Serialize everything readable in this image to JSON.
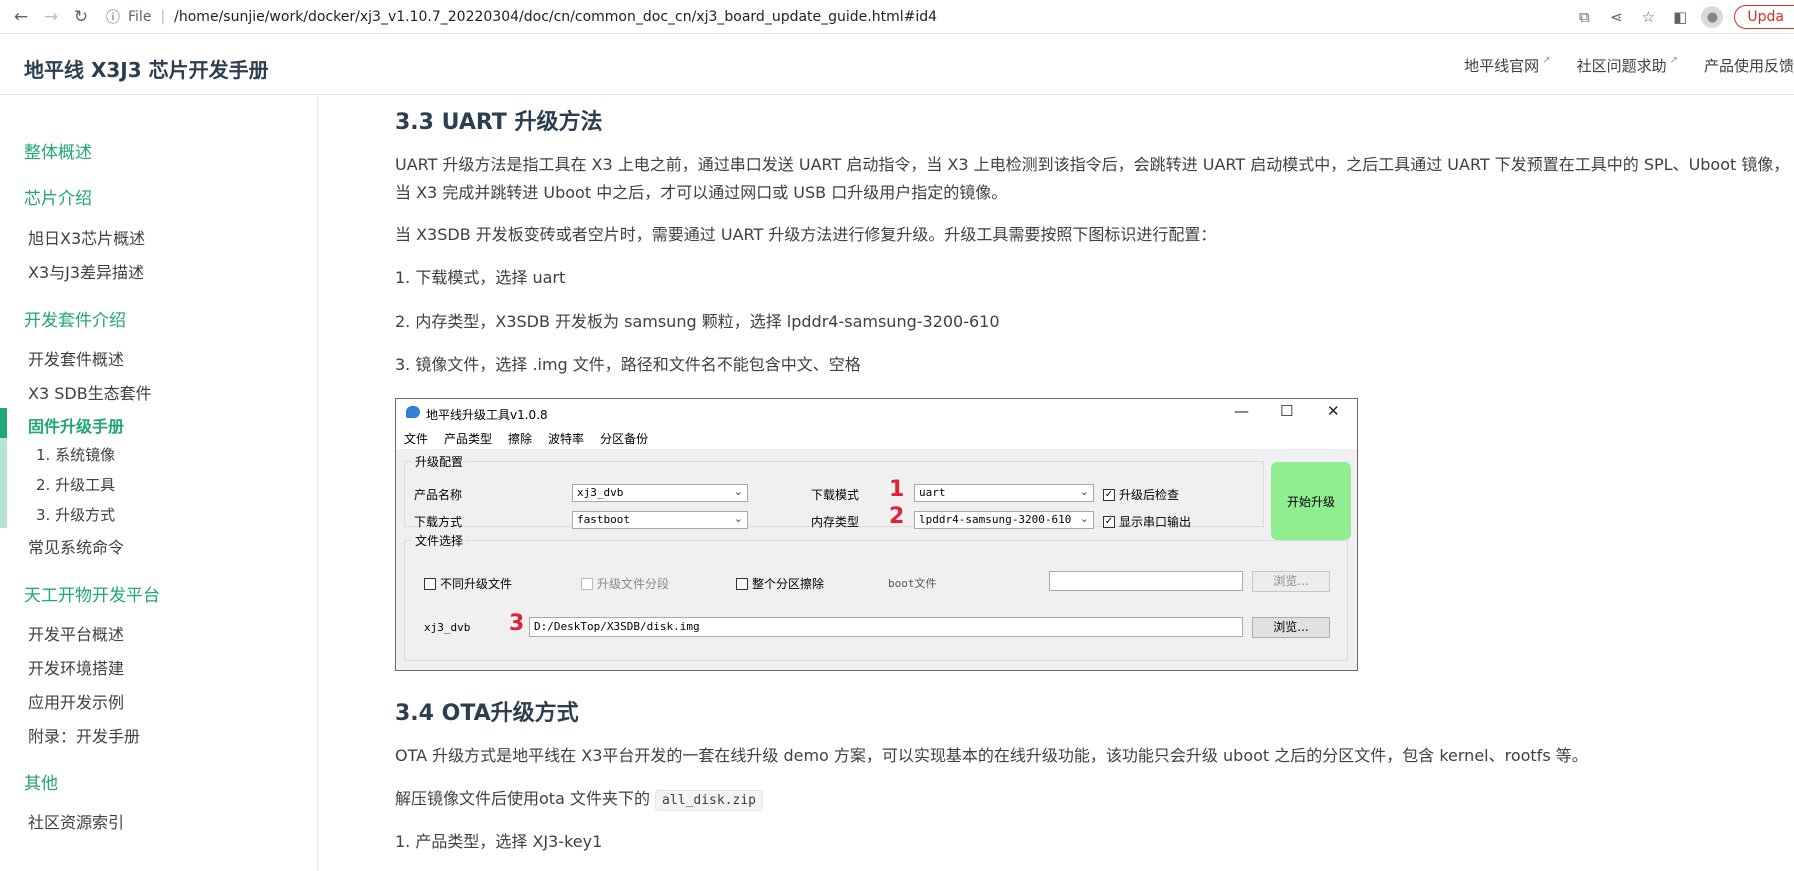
{
  "browser": {
    "file_label": "File",
    "url": "/home/sunjie/work/docker/xj3_v1.10.7_20220304/doc/cn/common_doc_cn/xj3_board_update_guide.html#id4",
    "update_label": "Upda"
  },
  "site": {
    "title": "地平线 X3J3 芯片开发手册",
    "links": [
      "地平线官网",
      "社区问题求助",
      "产品使用反馈"
    ]
  },
  "sidebar": {
    "sec_overview": "整体概述",
    "sec_chip": "芯片介绍",
    "chip_1": "旭日X3芯片概述",
    "chip_2": "X3与J3差异描述",
    "sec_kit": "开发套件介绍",
    "kit_1": "开发套件概述",
    "kit_2": "X3 SDB生态套件",
    "kit_3": "固件升级手册",
    "sub_1": "1. 系统镜像",
    "sub_2": "2. 升级工具",
    "sub_3": "3. 升级方式",
    "kit_4": "常见系统命令",
    "sec_platform": "天工开物开发平台",
    "plat_1": "开发平台概述",
    "plat_2": "开发环境搭建",
    "plat_3": "应用开发示例",
    "plat_4": "附录：开发手册",
    "sec_other": "其他",
    "other_1": "社区资源索引"
  },
  "content": {
    "h_uart": "3.3 UART 升级方法",
    "p1_line1": "UART 升级方法是指工具在 X3 上电之前，通过串口发送 UART 启动指令，当 X3 上电检测到该指令后，会跳转进 UART 启动模式中，之后工具通过 UART 下发预置在工具中的 SPL、Uboot 镜像，",
    "p1_line2": "当 X3 完成并跳转进 Uboot 中之后，才可以通过网口或 USB 口升级用户指定的镜像。",
    "p2": "当 X3SDB 开发板变砖或者空片时，需要通过 UART 升级方法进行修复升级。升级工具需要按照下图标识进行配置：",
    "step1": "1. 下载模式，选择 uart",
    "step2": "2. 内存类型，X3SDB 开发板为 samsung 颗粒，选择 lpddr4-samsung-3200-610",
    "step3": "3. 镜像文件，选择 .img 文件，路径和文件名不能包含中文、空格",
    "h_ota": "3.4 OTA升级方式",
    "p_ota": "OTA 升级方式是地平线在 X3平台开发的一套在线升级 demo 方案，可以实现基本的在线升级功能，该功能只会升级 uboot 之后的分区文件，包含 kernel、rootfs 等。",
    "p_unzip_pre": "解压镜像文件后使用ota 文件夹下的 ",
    "p_unzip_code": "all_disk.zip",
    "ota_step1": "1. 产品类型，选择 XJ3-key1"
  },
  "tool": {
    "title": "地平线升级工具v1.0.8",
    "menu": [
      "文件",
      "产品类型",
      "擦除",
      "波特率",
      "分区备份"
    ],
    "group_config": "升级配置",
    "product_name_label": "产品名称",
    "product_name_value": "xj3_dvb",
    "download_method_label": "下载方式",
    "download_method_value": "fastboot",
    "download_mode_label": "下载模式",
    "download_mode_value": "uart",
    "memory_type_label": "内存类型",
    "memory_type_value": "lpddr4-samsung-3200-610",
    "check_after_label": "升级后检查",
    "show_serial_label": "显示串口输出",
    "start_button": "开始升级",
    "group_files": "文件选择",
    "diff_files_label": "不同升级文件",
    "segmented_label": "升级文件分段",
    "erase_all_label": "整个分区擦除",
    "boot_file_label": "boot文件",
    "browse_label": "浏览...",
    "image_label": "xj3_dvb",
    "image_path": "D:/DeskTop/X3SDB/disk.img",
    "marks": [
      "1",
      "2",
      "3"
    ]
  }
}
